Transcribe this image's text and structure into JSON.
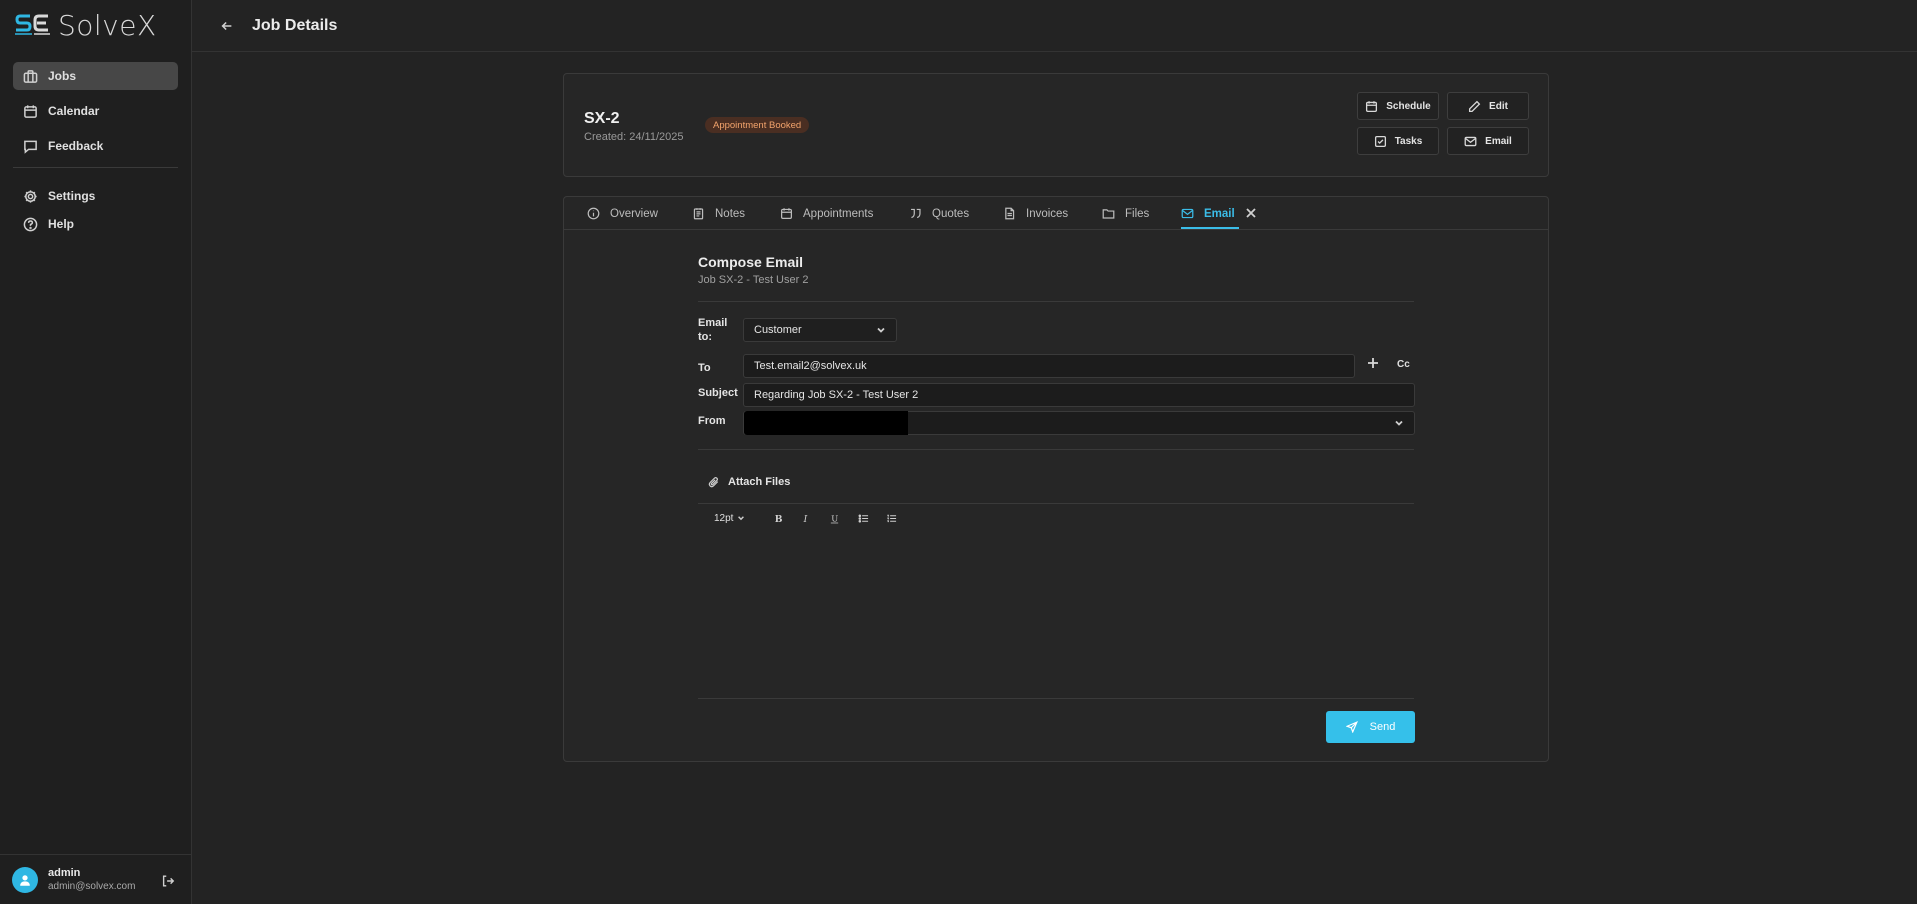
{
  "app": {
    "name": "SolveX",
    "logo_mark": "SE"
  },
  "sidebar": {
    "items": [
      {
        "label": "Jobs",
        "icon": "briefcase-icon",
        "active": true
      },
      {
        "label": "Calendar",
        "icon": "calendar-icon"
      },
      {
        "label": "Feedback",
        "icon": "message-icon"
      }
    ],
    "secondary": [
      {
        "label": "Settings",
        "icon": "gear-icon"
      },
      {
        "label": "Help",
        "icon": "help-circle-icon"
      }
    ],
    "user": {
      "name": "admin",
      "email": "admin@solvex.com"
    }
  },
  "header": {
    "title": "Job Details"
  },
  "job": {
    "id": "SX-2",
    "created": "Created: 24/11/2025",
    "status": "Appointment Booked",
    "actions": {
      "schedule": "Schedule",
      "edit": "Edit",
      "tasks": "Tasks",
      "email": "Email"
    }
  },
  "tabs": [
    {
      "label": "Overview",
      "icon": "info-icon"
    },
    {
      "label": "Notes",
      "icon": "notes-icon"
    },
    {
      "label": "Appointments",
      "icon": "calendar-icon"
    },
    {
      "label": "Quotes",
      "icon": "quote-icon"
    },
    {
      "label": "Invoices",
      "icon": "invoice-icon"
    },
    {
      "label": "Files",
      "icon": "folder-icon"
    },
    {
      "label": "Email",
      "icon": "mail-icon",
      "active": true
    }
  ],
  "compose": {
    "title": "Compose Email",
    "subtitle": "Job SX-2 - Test User 2",
    "email_to_label": "Email to:",
    "email_to_value": "Customer",
    "to_label": "To",
    "to_value": "Test.email2@solvex.uk",
    "cc_label": "Cc",
    "subject_label": "Subject",
    "subject_value": "Regarding Job SX-2 - Test User 2",
    "from_label": "From",
    "attach_label": "Attach Files",
    "font_size": "12pt",
    "send_label": "Send"
  },
  "colors": {
    "accent": "#35c0ea",
    "badge_bg": "#4a2e22",
    "badge_text": "#f2a36c"
  }
}
